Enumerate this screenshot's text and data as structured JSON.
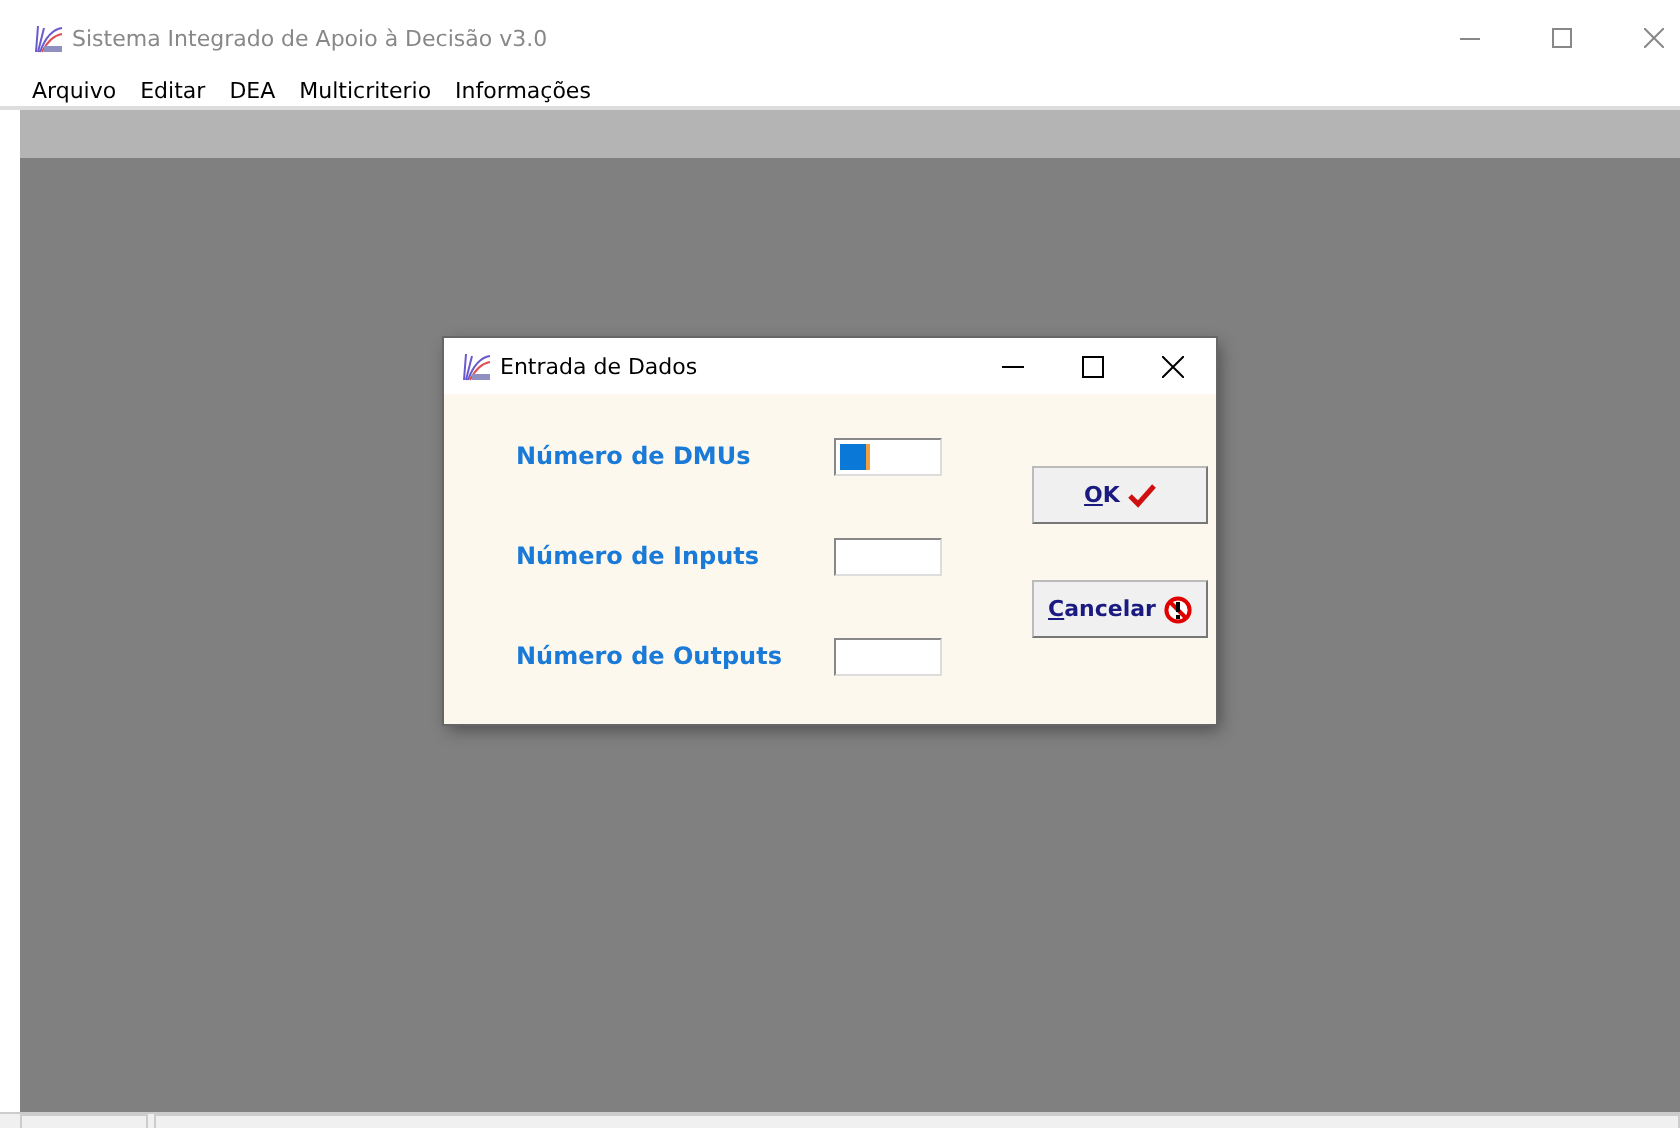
{
  "window": {
    "title": "Sistema Integrado de Apoio à Decisão v3.0"
  },
  "menu": [
    "Arquivo",
    "Editar",
    "DEA",
    "Multicriterio",
    "Informações"
  ],
  "dialog": {
    "title": "Entrada de Dados",
    "fields": [
      {
        "label": "Número de DMUs",
        "focused": true
      },
      {
        "label": "Número de Inputs",
        "focused": false
      },
      {
        "label": "Número de Outputs",
        "focused": false
      }
    ],
    "buttons": [
      {
        "label": "OK",
        "kind": "ok",
        "mnemonic_underlined": true
      },
      {
        "label": "Cancelar",
        "kind": "cancel",
        "mnemonic_underlined": true
      }
    ]
  }
}
